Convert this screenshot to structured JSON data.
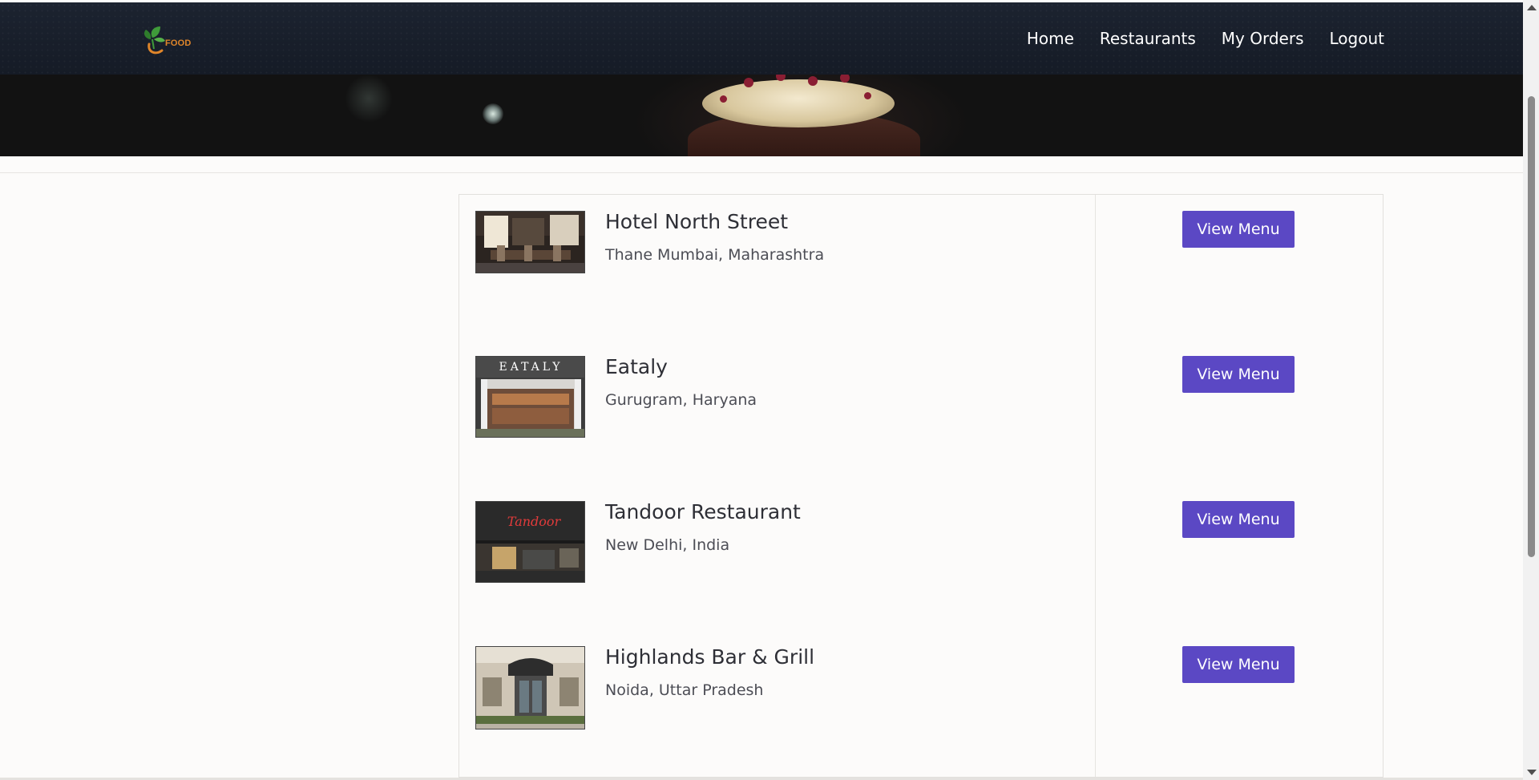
{
  "brand": {
    "logo_text": "FOOD",
    "accent": "#e0862a"
  },
  "nav": {
    "links": [
      {
        "label": "Home"
      },
      {
        "label": "Restaurants"
      },
      {
        "label": "My Orders"
      },
      {
        "label": "Logout"
      }
    ]
  },
  "restaurants": [
    {
      "name": "Hotel North Street",
      "location": "Thane Mumbai, Maharashtra",
      "button": "View Menu",
      "image_text": ""
    },
    {
      "name": "Eataly",
      "location": "Gurugram, Haryana",
      "button": "View Menu",
      "image_text": "EATALY"
    },
    {
      "name": "Tandoor Restaurant",
      "location": "New Delhi, India",
      "button": "View Menu",
      "image_text": "Tandoor"
    },
    {
      "name": "Highlands Bar & Grill",
      "location": "Noida, Uttar Pradesh",
      "button": "View Menu",
      "image_text": ""
    }
  ],
  "colors": {
    "button_bg": "#5b48c4",
    "navbar_bg": "#1c2330"
  }
}
